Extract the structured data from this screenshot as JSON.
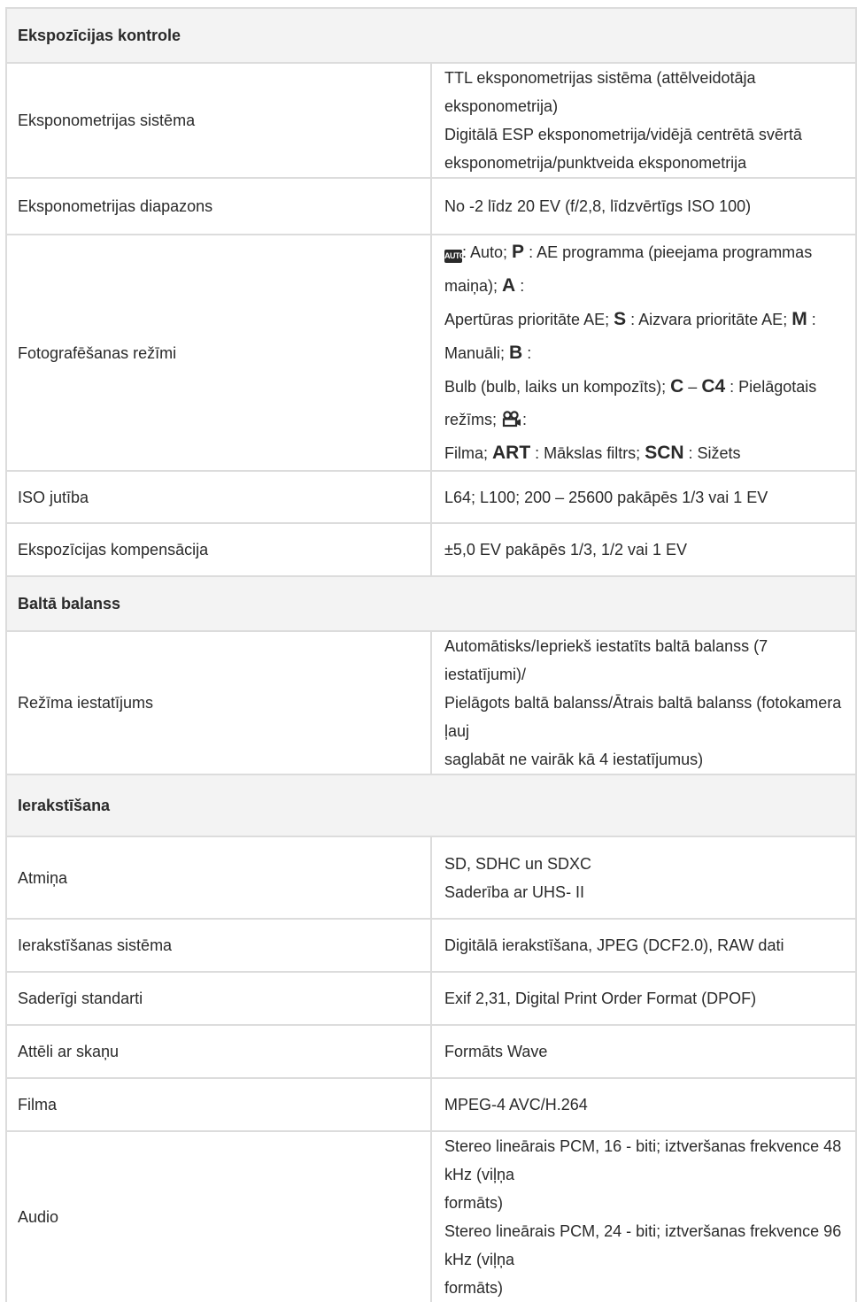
{
  "sections": {
    "exposure": {
      "title": "Ekspozīcijas kontrole",
      "rows": [
        {
          "label": "Eksponometrijas sistēma",
          "lines": [
            "TTL eksponometrijas sistēma (attēlveidotāja eksponometrija)",
            "Digitālā ESP eksponometrija/vidējā centrētā svērtā",
            "eksponometrija/punktveida eksponometrija"
          ]
        },
        {
          "label": "Eksponometrijas diapazons",
          "value": "No -2 līdz 20 EV (f/2,8, līdzvērtīgs ISO 100)"
        },
        {
          "label": "Fotografēšanas režīmi",
          "modes": {
            "auto_icon": "AUTO",
            "auto_text": ": Auto; ",
            "p": "P",
            "p_text": " : AE programma (pieejama programmas maiņa); ",
            "a": "A",
            "a_text": " :",
            "a_text2": "Apertūras prioritāte AE; ",
            "s": "S",
            "s_text": " : Aizvara prioritāte AE; ",
            "m": "M",
            "m_text": " : Manuāli; ",
            "bb": "B",
            "bb_text": " :",
            "bulb_text": "Bulb (bulb, laiks un kompozīts); ",
            "c": "C",
            "dash": " – ",
            "c4": "C4",
            "c_text": " : Pielāgotais režīms; ",
            "movie_icon": "movie-camera-icon",
            "movie_colon": ":",
            "filma_text": "Filma; ",
            "art": "ART",
            "art_text": " : Mākslas filtrs; ",
            "scn": "SCN",
            "scn_text": " : Sižets"
          }
        },
        {
          "label": "ISO jutība",
          "value": "L64; L100; 200 – 25600 pakāpēs 1/3 vai 1 EV"
        },
        {
          "label": "Ekspozīcijas kompensācija",
          "value": "±5,0 EV pakāpēs 1/3, 1/2 vai 1 EV"
        }
      ]
    },
    "white_balance": {
      "title": "Baltā balanss",
      "rows": [
        {
          "label": "Režīma iestatījums",
          "lines": [
            "Automātisks/Iepriekš iestatīts baltā balanss (7 iestatījumi)/",
            "Pielāgots baltā balanss/Ātrais baltā balanss (fotokamera ļauj",
            "saglabāt ne vairāk kā 4 iestatījumus)"
          ]
        }
      ]
    },
    "recording": {
      "title": "Ierakstīšana",
      "rows": [
        {
          "label": "Atmiņa",
          "lines": [
            "SD, SDHC un SDXC",
            "Saderība ar UHS- II"
          ]
        },
        {
          "label": "Ierakstīšanas sistēma",
          "value": "Digitālā ierakstīšana, JPEG (DCF2.0), RAW dati"
        },
        {
          "label": "Saderīgi standarti",
          "value": "Exif 2,31, Digital Print Order Format (DPOF)"
        },
        {
          "label": "Attēli ar skaņu",
          "value": "Formāts Wave"
        },
        {
          "label": "Filma",
          "value": "MPEG-4 AVC/H.264"
        },
        {
          "label": "Audio",
          "lines": [
            "Stereo lineārais PCM, 16 - biti; iztveršanas frekvence 48 kHz (viļņa",
            "formāts)",
            "Stereo lineārais PCM, 24 - biti; iztveršanas frekvence 96 kHz (viļņa",
            "formāts)"
          ]
        }
      ]
    }
  }
}
